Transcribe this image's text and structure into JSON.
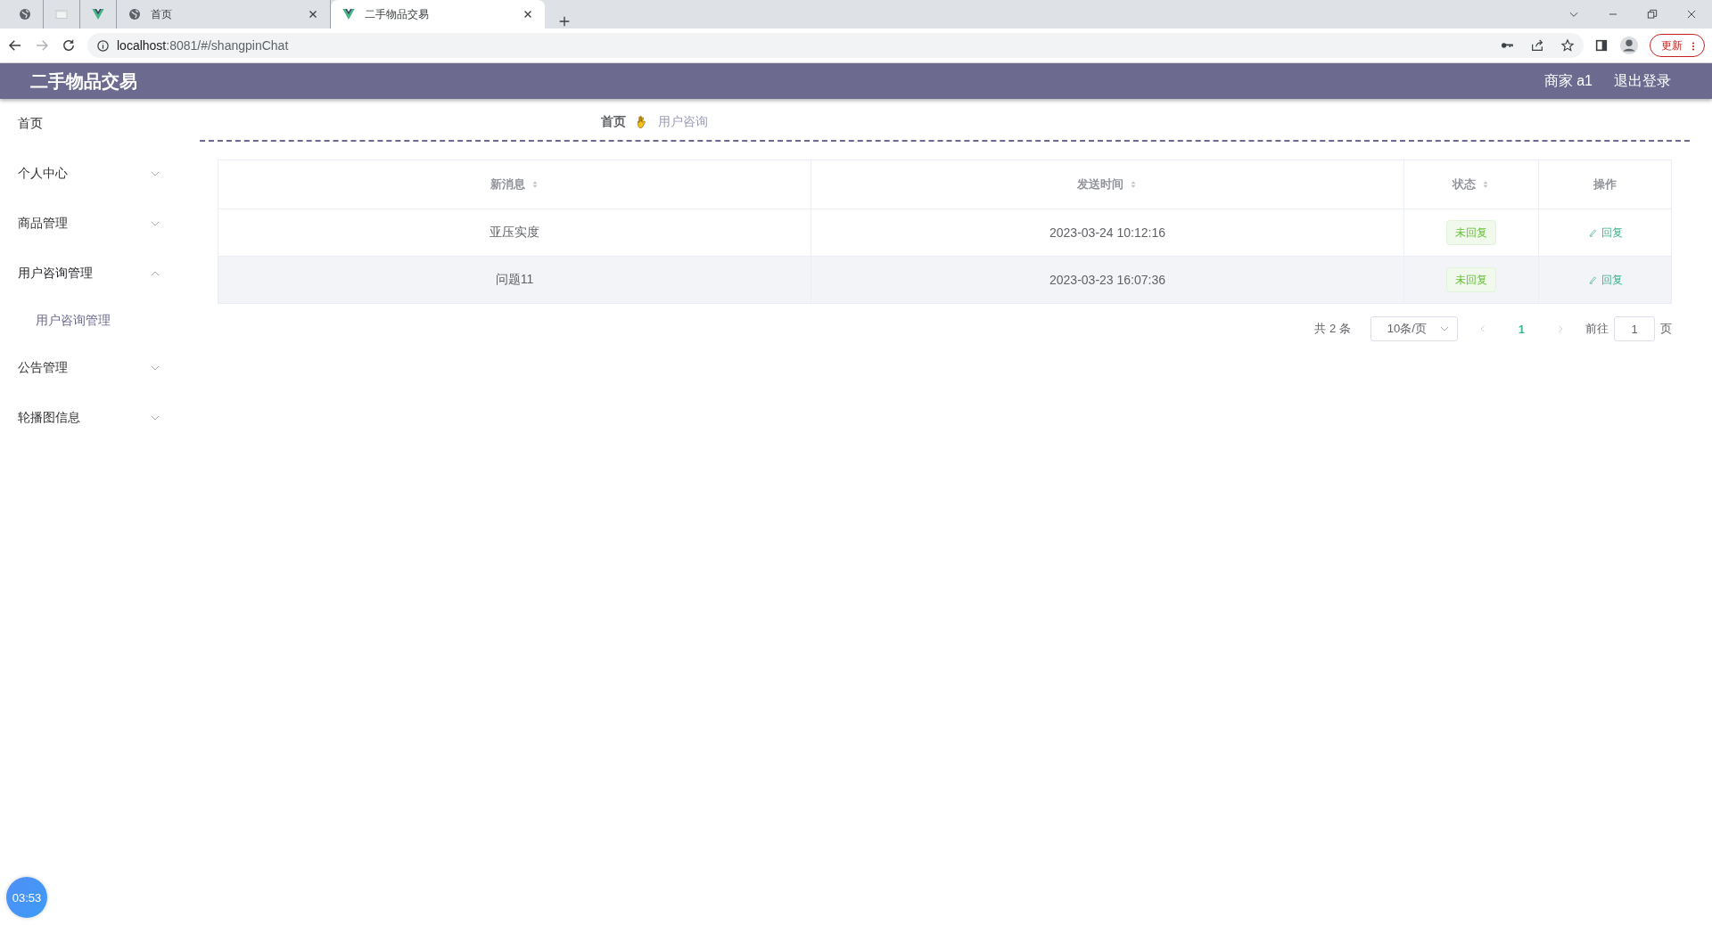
{
  "browser": {
    "tabs": [
      {
        "kind": "globe",
        "selected": false
      },
      {
        "kind": "page",
        "selected": false
      },
      {
        "kind": "vue",
        "selected": false
      },
      {
        "kind": "globe",
        "title": "首页",
        "selected": false
      },
      {
        "kind": "vue",
        "title": "二手物品交易",
        "selected": true
      }
    ],
    "address": {
      "host": "localhost",
      "rest": ":8081/#/shangpinChat"
    },
    "update_button": "更新"
  },
  "header": {
    "title": "二手物品交易",
    "user": "商家 a1",
    "logout": "退出登录"
  },
  "sidebar": {
    "items": [
      {
        "label": "首页",
        "kind": "link"
      },
      {
        "label": "个人中心",
        "kind": "submenu",
        "expanded": false
      },
      {
        "label": "商品管理",
        "kind": "submenu",
        "expanded": false
      },
      {
        "label": "用户咨询管理",
        "kind": "submenu",
        "expanded": true,
        "children": [
          {
            "label": "用户咨询管理"
          }
        ]
      },
      {
        "label": "公告管理",
        "kind": "submenu",
        "expanded": false
      },
      {
        "label": "轮播图信息",
        "kind": "submenu",
        "expanded": false
      }
    ]
  },
  "breadcrumb": [
    "首页",
    "用户咨询"
  ],
  "table": {
    "columns": [
      {
        "label": "新消息",
        "sortable": true
      },
      {
        "label": "发送时间",
        "sortable": true
      },
      {
        "label": "状态",
        "sortable": true
      },
      {
        "label": "操作",
        "sortable": false
      }
    ],
    "rows": [
      {
        "message": "亚压实度",
        "time": "2023-03-24 10:12:16",
        "status": "未回复",
        "action": "回复",
        "hovered": false
      },
      {
        "message": "问题11",
        "time": "2023-03-23 16:07:36",
        "status": "未回复",
        "action": "回复",
        "hovered": true
      }
    ]
  },
  "pagination": {
    "total": "共 2 条",
    "page_size": "10条/页",
    "pages": [
      {
        "label": "1",
        "selected": true
      }
    ],
    "goto_label": "前往",
    "goto_value": "1",
    "goto_suffix": "页"
  },
  "timer": "03:53"
}
